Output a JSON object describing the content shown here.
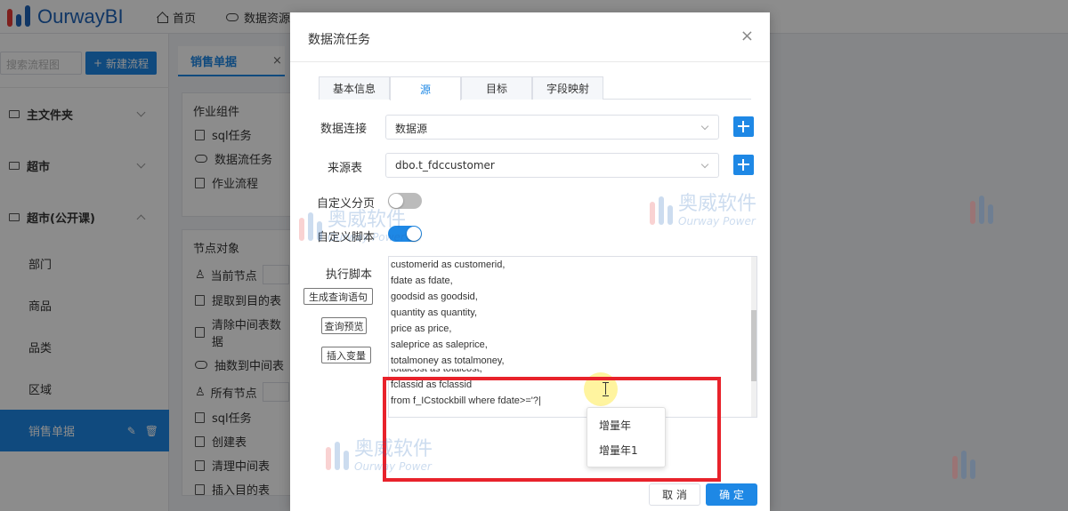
{
  "app": {
    "logo_text": "OurwayBI",
    "nav": [
      {
        "label": "首页",
        "icon": "home-icon"
      },
      {
        "label": "数据资源",
        "icon": "cloud-icon"
      }
    ]
  },
  "sidebar": {
    "search_placeholder": "搜索流程图",
    "new_flow_label": "新建流程",
    "folders": [
      {
        "label": "主文件夹",
        "expanded": false
      },
      {
        "label": "超市",
        "expanded": false
      },
      {
        "label": "超市(公开课)",
        "expanded": true
      }
    ],
    "items": [
      "部门",
      "商品",
      "品类",
      "区域",
      "销售单据"
    ],
    "active_item": "销售单据"
  },
  "workspace": {
    "tab_label": "销售单据",
    "tab_close": "×",
    "components_title": "作业组件",
    "components": [
      "sql任务",
      "数据流任务",
      "作业流程"
    ],
    "nodes_title": "节点对象",
    "current_nodes_label": "当前节点",
    "current_nodes": [
      "提取到目的表",
      "清除中间表数据",
      "抽数到中间表"
    ],
    "all_nodes_label": "所有节点",
    "all_nodes": [
      "sql任务",
      "创建表",
      "清理中间表",
      "插入目的表"
    ]
  },
  "dialog": {
    "title": "数据流任务",
    "close": "×",
    "tabs": [
      {
        "label": "基本信息",
        "active": false
      },
      {
        "label": "源",
        "active": true
      },
      {
        "label": "目标",
        "active": false
      },
      {
        "label": "字段映射",
        "active": false
      }
    ],
    "connection": {
      "label": "数据连接",
      "value": "数据源"
    },
    "source_table": {
      "label": "来源表",
      "value": "dbo.t_fdccustomer"
    },
    "custom_paging": {
      "label": "自定义分页",
      "on": false
    },
    "custom_script": {
      "label": "自定义脚本",
      "on": true
    },
    "exec_script_label": "执行脚本",
    "buttons": {
      "generate": "生成查询语句",
      "preview": "查询预览",
      "insert_var": "插入变量"
    },
    "script_lines": [
      "customerid as customerid,",
      "fdate as fdate,",
      "goodsid as goodsid,",
      "quantity as quantity,",
      "price as price,",
      "saleprice as saleprice,",
      "totalmoney as totalmoney,",
      "totalcost as totalcost,",
      "fclassid as fclassid",
      "from f_ICstockbill where fdate>='?|"
    ],
    "autocomplete": [
      "增量年",
      "增量年1"
    ],
    "cancel": "取 消",
    "ok": "确 定"
  },
  "watermark": {
    "cn": "奥威软件",
    "en": "Ourway Power"
  },
  "colors": {
    "accent": "#1e88e5",
    "highlight": "#e8222b",
    "brand_red": "#e53935",
    "brand_blue": "#1e63b8"
  }
}
